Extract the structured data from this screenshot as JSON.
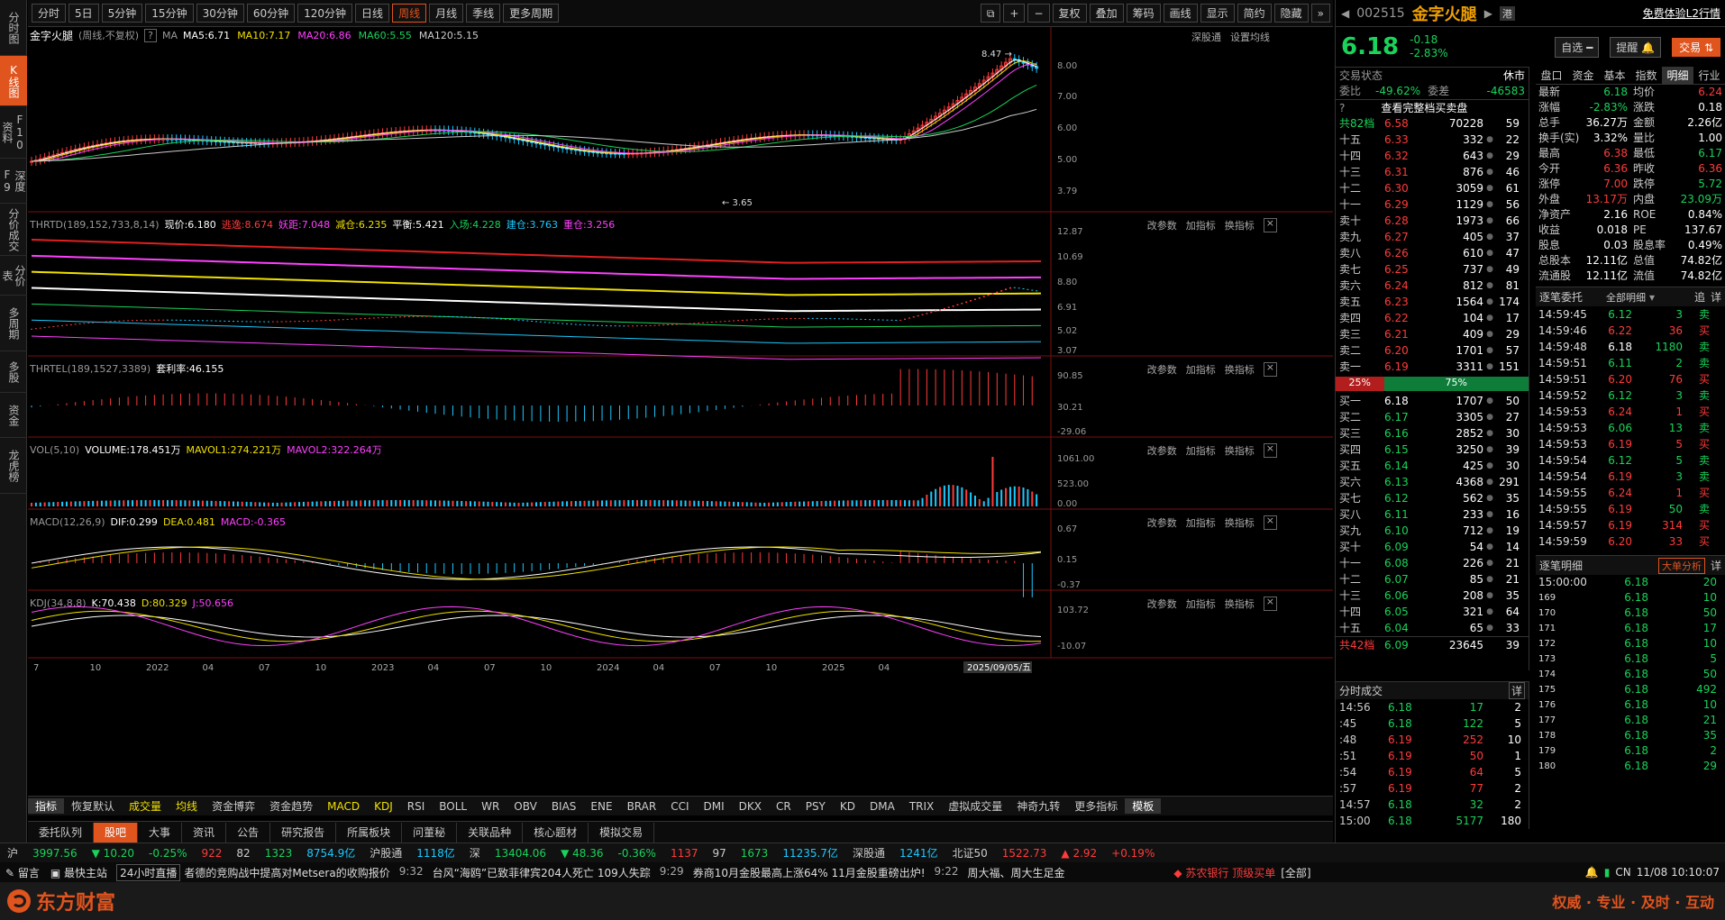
{
  "left_nav": [
    "分时图",
    "K线图",
    "F10资料",
    "深度F9",
    "分价成交",
    "分价表",
    "多周期",
    "多股",
    "资金",
    "龙虎榜"
  ],
  "top_bar": {
    "periods": [
      "分时",
      "5日",
      "5分钟",
      "15分钟",
      "30分钟",
      "60分钟",
      "120分钟",
      "日线",
      "周线",
      "月线",
      "季线",
      "更多周期"
    ],
    "active": "周线",
    "tools": [
      "复权",
      "叠加",
      "筹码",
      "画线",
      "显示",
      "简约",
      "隐藏"
    ]
  },
  "chart": {
    "title": "金字火腿",
    "subtitle": "(周线,不复权)",
    "ma_label": "MA",
    "ma": [
      {
        "label": "MA5:6.71",
        "color": "#ffffff"
      },
      {
        "label": "MA10:7.17",
        "color": "#f0e000"
      },
      {
        "label": "MA20:6.86",
        "color": "#ff40ff"
      },
      {
        "label": "MA60:5.55",
        "color": "#19d35a"
      },
      {
        "label": "MA120:5.15",
        "color": "#cccccc"
      }
    ],
    "right_links": [
      "深股通",
      "设置均线"
    ],
    "price_axis": [
      "8.00",
      "7.00",
      "6.00",
      "5.00",
      "3.79"
    ],
    "high_label": "8.47",
    "low_label": "3.65",
    "thrtd": {
      "name": "THRTD(189,152,733,8,14)",
      "items": [
        {
          "t": "现价:6.180",
          "c": "#ffffff"
        },
        {
          "t": "逃逸:8.674",
          "c": "#ff3b3b"
        },
        {
          "t": "妖距:7.048",
          "c": "#ff40ff"
        },
        {
          "t": "减仓:6.235",
          "c": "#f0e000"
        },
        {
          "t": "平衡:5.421",
          "c": "#ffffff"
        },
        {
          "t": "入场:4.228",
          "c": "#19d35a"
        },
        {
          "t": "建仓:3.763",
          "c": "#1cc9ff"
        },
        {
          "t": "重仓:3.256",
          "c": "#ff40ff"
        }
      ],
      "axis": [
        "12.87",
        "10.69",
        "8.80",
        "6.91",
        "5.02",
        "3.07"
      ]
    },
    "thrtel": {
      "name": "THRTEL(189,1527,3389)",
      "items": [
        {
          "t": "套利率:46.155",
          "c": "#ffffff"
        }
      ],
      "axis": [
        "90.85",
        "30.21",
        "-29.06"
      ]
    },
    "vol": {
      "name": "VOL(5,10)",
      "items": [
        {
          "t": "VOLUME:178.451万",
          "c": "#ffffff"
        },
        {
          "t": "MAVOL1:274.221万",
          "c": "#f0e000"
        },
        {
          "t": "MAVOL2:322.264万",
          "c": "#ff40ff"
        }
      ],
      "axis": [
        "1061.00",
        "523.00",
        "0.00"
      ]
    },
    "macd": {
      "name": "MACD(12,26,9)",
      "items": [
        {
          "t": "DIF:0.299",
          "c": "#ffffff"
        },
        {
          "t": "DEA:0.481",
          "c": "#f0e000"
        },
        {
          "t": "MACD:-0.365",
          "c": "#ff40ff"
        }
      ],
      "axis": [
        "0.67",
        "0.15",
        "-0.37"
      ]
    },
    "kdj": {
      "name": "KDJ(34,8,8)",
      "items": [
        {
          "t": "K:70.438",
          "c": "#ffffff"
        },
        {
          "t": "D:80.329",
          "c": "#f0e000"
        },
        {
          "t": "J:50.656",
          "c": "#ff40ff"
        }
      ],
      "axis": [
        "103.72",
        "-10.07"
      ]
    },
    "panel_links": [
      "改参数",
      "加指标",
      "换指标"
    ],
    "x_axis": [
      "7",
      "10",
      "2022",
      "04",
      "07",
      "10",
      "2023",
      "04",
      "07",
      "10",
      "2024",
      "04",
      "07",
      "10",
      "2025",
      "04"
    ],
    "cursor_date": "2025/09/05/五"
  },
  "indicators": [
    "指标",
    "恢复默认",
    "成交量",
    "均线",
    "资金博弈",
    "资金趋势",
    "MACD",
    "KDJ",
    "RSI",
    "BOLL",
    "WR",
    "OBV",
    "BIAS",
    "ENE",
    "BRAR",
    "CCI",
    "DMI",
    "DKX",
    "CR",
    "PSY",
    "KD",
    "DMA",
    "TRIX",
    "虚拟成交量",
    "神奇九转",
    "更多指标",
    "模板"
  ],
  "bottom_tabs": [
    "委托队列",
    "股吧",
    "大事",
    "资讯",
    "公告",
    "研究报告",
    "所属板块",
    "问董秘",
    "关联品种",
    "核心题材",
    "模拟交易"
  ],
  "stock": {
    "code": "002515",
    "name": "金字火腿",
    "price": "6.18",
    "change": "-0.18",
    "pct": "-2.83%",
    "hk_tag": "港",
    "promo": "免费体验L2行情",
    "btn_watch": "自选",
    "btn_alert": "提醒",
    "btn_trade": "交易"
  },
  "order_book": {
    "status_label": "交易状态",
    "status": "休市",
    "ratio_label": "委比",
    "ratio": "-49.62%",
    "diff_label": "委差",
    "diff": "-46583",
    "full_book": "查看完整档买卖盘",
    "sell_total": {
      "label": "共82档",
      "price": "6.58",
      "vol": "70228",
      "n": "59"
    },
    "sells": [
      [
        "十五",
        "6.33",
        "332",
        "22"
      ],
      [
        "十四",
        "6.32",
        "643",
        "29"
      ],
      [
        "十三",
        "6.31",
        "876",
        "46"
      ],
      [
        "十二",
        "6.30",
        "3059",
        "61"
      ],
      [
        "十一",
        "6.29",
        "1129",
        "56"
      ],
      [
        "卖十",
        "6.28",
        "1973",
        "66"
      ],
      [
        "卖九",
        "6.27",
        "405",
        "37"
      ],
      [
        "卖八",
        "6.26",
        "610",
        "47"
      ],
      [
        "卖七",
        "6.25",
        "737",
        "49"
      ],
      [
        "卖六",
        "6.24",
        "812",
        "81"
      ],
      [
        "卖五",
        "6.23",
        "1564",
        "174"
      ],
      [
        "卖四",
        "6.22",
        "104",
        "17"
      ],
      [
        "卖三",
        "6.21",
        "409",
        "29"
      ],
      [
        "卖二",
        "6.20",
        "1701",
        "57"
      ],
      [
        "卖一",
        "6.19",
        "3311",
        "151"
      ]
    ],
    "bar_left": "25%",
    "bar_right": "75%",
    "buys": [
      [
        "买一",
        "6.18",
        "1707",
        "50"
      ],
      [
        "买二",
        "6.17",
        "3305",
        "27"
      ],
      [
        "买三",
        "6.16",
        "2852",
        "30"
      ],
      [
        "买四",
        "6.15",
        "3250",
        "39"
      ],
      [
        "买五",
        "6.14",
        "425",
        "30"
      ],
      [
        "买六",
        "6.13",
        "4368",
        "291"
      ],
      [
        "买七",
        "6.12",
        "562",
        "35"
      ],
      [
        "买八",
        "6.11",
        "233",
        "16"
      ],
      [
        "买九",
        "6.10",
        "712",
        "19"
      ],
      [
        "买十",
        "6.09",
        "54",
        "14"
      ],
      [
        "十一",
        "6.08",
        "226",
        "21"
      ],
      [
        "十二",
        "6.07",
        "85",
        "21"
      ],
      [
        "十三",
        "6.06",
        "208",
        "35"
      ],
      [
        "十四",
        "6.05",
        "321",
        "64"
      ],
      [
        "十五",
        "6.04",
        "65",
        "33"
      ]
    ],
    "buy_total": {
      "label": "共42档",
      "price": "6.09",
      "vol": "23645",
      "n": "39"
    }
  },
  "tick_summary": {
    "title": "分时成交",
    "detail": "详",
    "rows": [
      [
        "14:56",
        "6.18",
        "17",
        "2"
      ],
      [
        ":45",
        "6.18",
        "122",
        "5"
      ],
      [
        ":48",
        "6.19",
        "252",
        "10"
      ],
      [
        ":51",
        "6.19",
        "50",
        "1"
      ],
      [
        ":54",
        "6.19",
        "64",
        "5"
      ],
      [
        ":57",
        "6.19",
        "77",
        "2"
      ],
      [
        "14:57",
        "6.18",
        "32",
        "2"
      ],
      [
        "15:00",
        "6.18",
        "5177",
        "180"
      ]
    ]
  },
  "tabs_right": [
    "盘口",
    "资金",
    "基本",
    "指数",
    "明细",
    "行业"
  ],
  "quote": [
    [
      "最新",
      "6.18",
      "均价",
      "6.24"
    ],
    [
      "涨幅",
      "-2.83%",
      "涨跌",
      "0.18"
    ],
    [
      "总手",
      "36.27万",
      "金额",
      "2.26亿"
    ],
    [
      "换手(实)",
      "3.32%",
      "量比",
      "1.00"
    ],
    [
      "最高",
      "6.38",
      "最低",
      "6.17"
    ],
    [
      "今开",
      "6.36",
      "昨收",
      "6.36"
    ],
    [
      "涨停",
      "7.00",
      "跌停",
      "5.72"
    ],
    [
      "外盘",
      "13.17万",
      "内盘",
      "23.09万"
    ],
    [
      "净资产",
      "2.16",
      "ROE",
      "0.84%"
    ],
    [
      "收益",
      "0.018",
      "PE",
      "137.67"
    ],
    [
      "股息",
      "0.03",
      "股息率",
      "0.49%"
    ],
    [
      "总股本",
      "12.11亿",
      "总值",
      "74.82亿"
    ],
    [
      "流通股",
      "12.11亿",
      "流值",
      "74.82亿"
    ]
  ],
  "entrust": {
    "title": "逐笔委托",
    "filter": "全部明细",
    "chase": "追",
    "detail": "详",
    "rows": [
      [
        "14:59:45",
        "6.12",
        "3",
        "卖"
      ],
      [
        "14:59:46",
        "6.22",
        "36",
        "买"
      ],
      [
        "14:59:48",
        "6.18",
        "1180",
        "卖"
      ],
      [
        "14:59:51",
        "6.11",
        "2",
        "卖"
      ],
      [
        "14:59:51",
        "6.20",
        "76",
        "买"
      ],
      [
        "14:59:52",
        "6.12",
        "3",
        "卖"
      ],
      [
        "14:59:53",
        "6.24",
        "1",
        "买"
      ],
      [
        "14:59:53",
        "6.06",
        "13",
        "卖"
      ],
      [
        "14:59:53",
        "6.19",
        "5",
        "买"
      ],
      [
        "14:59:54",
        "6.12",
        "5",
        "卖"
      ],
      [
        "14:59:54",
        "6.19",
        "3",
        "卖"
      ],
      [
        "14:59:55",
        "6.24",
        "1",
        "买"
      ],
      [
        "14:59:55",
        "6.19",
        "50",
        "卖"
      ],
      [
        "14:59:57",
        "6.19",
        "314",
        "买"
      ],
      [
        "14:59:59",
        "6.20",
        "33",
        "买"
      ]
    ]
  },
  "trades": {
    "title": "逐笔明细",
    "analysis": "大单分析",
    "detail": "详",
    "rows": [
      [
        "15:00:00",
        "6.18",
        "20"
      ],
      [
        "169",
        "6.18",
        "10"
      ],
      [
        "170",
        "6.18",
        "50"
      ],
      [
        "171",
        "6.18",
        "17"
      ],
      [
        "172",
        "6.18",
        "10"
      ],
      [
        "173",
        "6.18",
        "5"
      ],
      [
        "174",
        "6.18",
        "50"
      ],
      [
        "175",
        "6.18",
        "492"
      ],
      [
        "176",
        "6.18",
        "10"
      ],
      [
        "177",
        "6.18",
        "21"
      ],
      [
        "178",
        "6.18",
        "35"
      ],
      [
        "179",
        "6.18",
        "2"
      ],
      [
        "180",
        "6.18",
        "29"
      ]
    ]
  },
  "ticker": [
    {
      "k": "沪",
      "c": "#ccc"
    },
    {
      "k": "3997.56",
      "c": "#19d35a"
    },
    {
      "k": "▼ 10.20",
      "c": "#19d35a"
    },
    {
      "k": "-0.25%",
      "c": "#19d35a"
    },
    {
      "k": "922",
      "c": "#ff3b3b"
    },
    {
      "k": "82",
      "c": "#ccc"
    },
    {
      "k": "1323",
      "c": "#19d35a"
    },
    {
      "k": "8754.9亿",
      "c": "#1cc9ff"
    },
    {
      "k": "沪股通",
      "c": "#ccc"
    },
    {
      "k": "1118亿",
      "c": "#1cc9ff"
    },
    {
      "k": "深",
      "c": "#ccc"
    },
    {
      "k": "13404.06",
      "c": "#19d35a"
    },
    {
      "k": "▼ 48.36",
      "c": "#19d35a"
    },
    {
      "k": "-0.36%",
      "c": "#19d35a"
    },
    {
      "k": "1137",
      "c": "#ff3b3b"
    },
    {
      "k": "97",
      "c": "#ccc"
    },
    {
      "k": "1673",
      "c": "#19d35a"
    },
    {
      "k": "11235.7亿",
      "c": "#1cc9ff"
    },
    {
      "k": "深股通",
      "c": "#ccc"
    },
    {
      "k": "1241亿",
      "c": "#1cc9ff"
    },
    {
      "k": "北证50",
      "c": "#ccc"
    },
    {
      "k": "1522.73",
      "c": "#ff3b3b"
    },
    {
      "k": "▲ 2.92",
      "c": "#ff3b3b"
    },
    {
      "k": "+0.19%",
      "c": "#ff3b3b"
    }
  ],
  "news": {
    "msg": "留言",
    "quick": "最快主站",
    "live": "24小时直播",
    "items": [
      "者德的竞购战中提高对Metsera的收购报价",
      "9:32",
      "台风“海鸥”已致菲律宾204人死亡  109人失踪",
      "9:29",
      "券商10月金股最高上涨64%  11月金股重磅出炉!",
      "9:22",
      "周大福、周大生足金"
    ],
    "bank": "◆ 苏农银行 顶级买单",
    "all": "[全部]",
    "region": "CN",
    "time": "11/08  10:10:07"
  },
  "brand": {
    "name": "东方财富",
    "slogan": "权威 · 专业 · 及时 · 互动"
  }
}
